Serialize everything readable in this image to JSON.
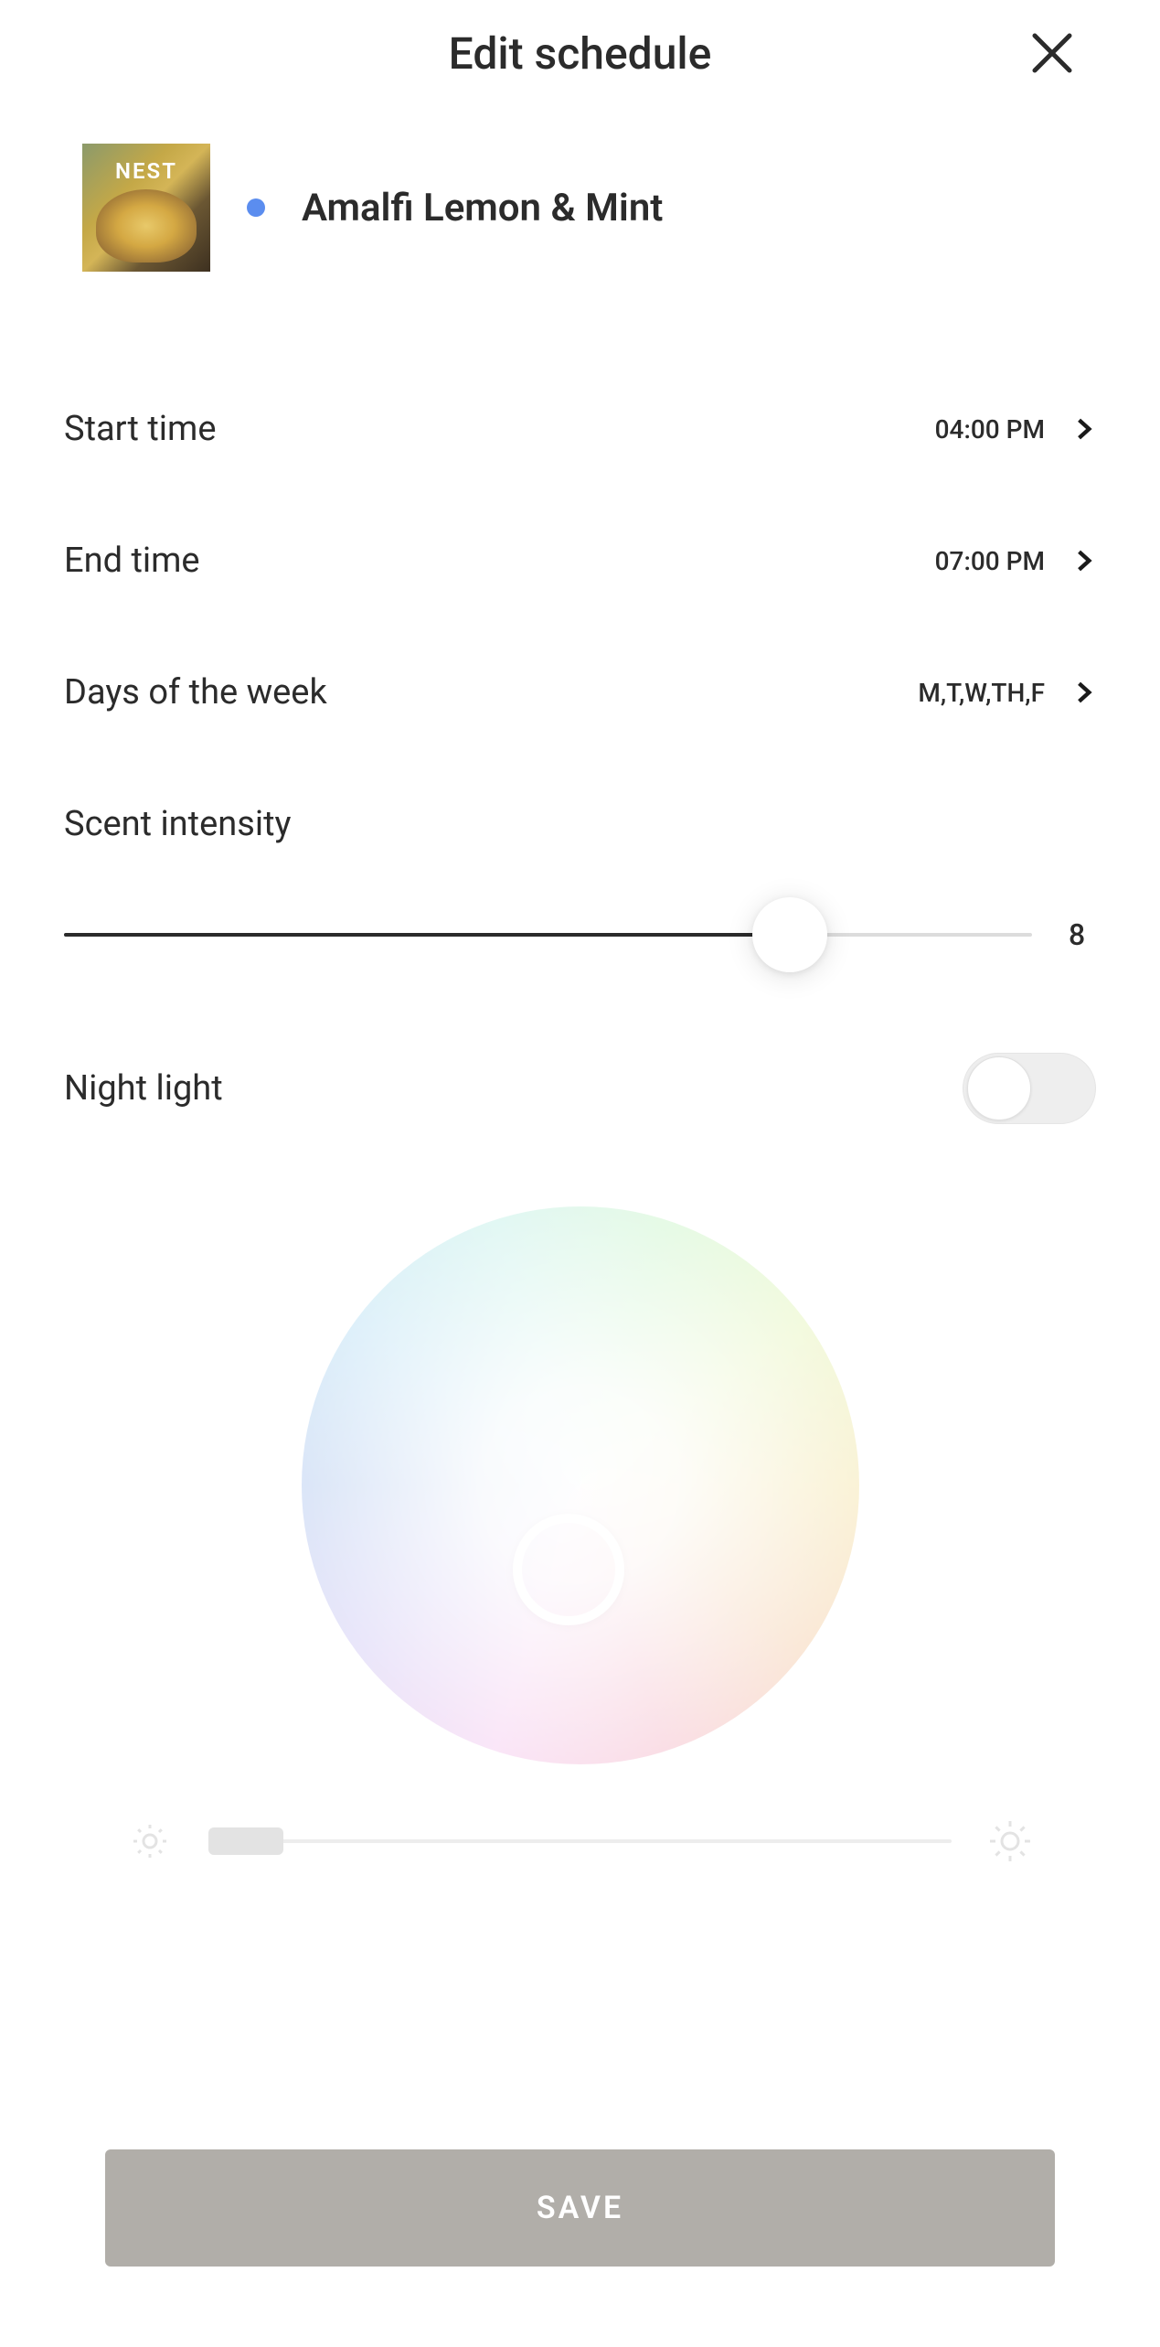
{
  "header": {
    "title": "Edit schedule"
  },
  "product": {
    "brand": "NEST",
    "name": "Amalfi Lemon & Mint",
    "status_color": "#5b8def"
  },
  "settings": {
    "start_time": {
      "label": "Start time",
      "value": "04:00 PM"
    },
    "end_time": {
      "label": "End time",
      "value": "07:00 PM"
    },
    "days": {
      "label": "Days of the week",
      "value": "M,T,W,TH,F"
    }
  },
  "intensity": {
    "label": "Scent intensity",
    "value": "8",
    "percent": 75
  },
  "night_light": {
    "label": "Night light",
    "enabled": false
  },
  "save": {
    "label": "SAVE"
  }
}
